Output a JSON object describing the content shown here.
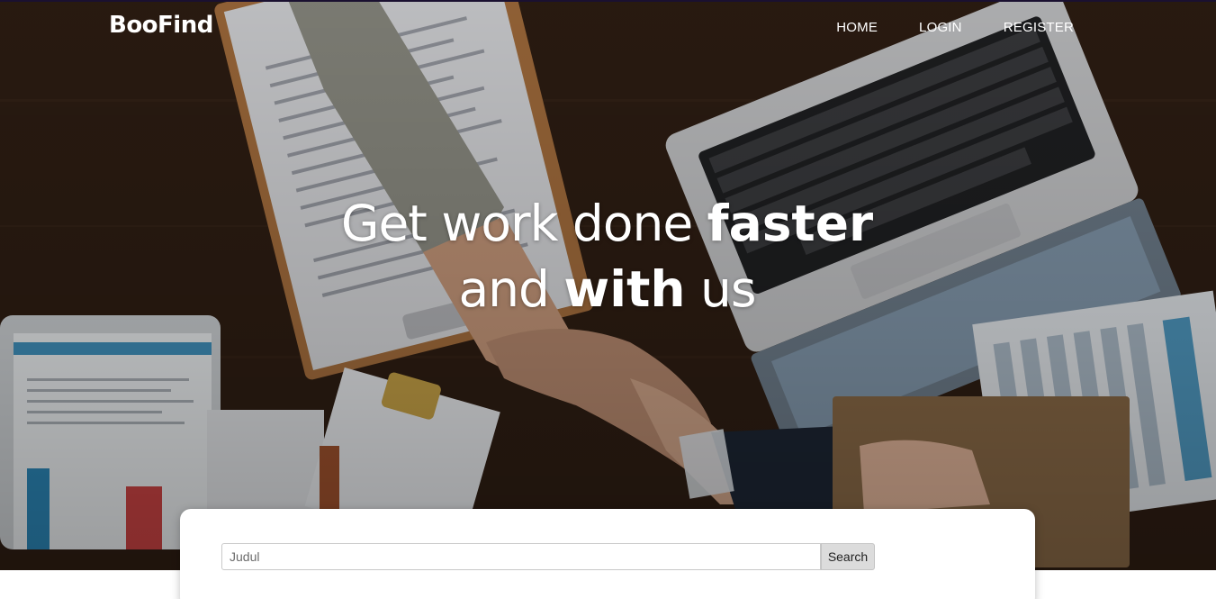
{
  "brand": {
    "name": "BooFind"
  },
  "nav": {
    "items": [
      {
        "label": "HOME"
      },
      {
        "label": "LOGIN"
      },
      {
        "label": "REGISTER"
      }
    ]
  },
  "hero": {
    "headline_line1_normal": "Get work done ",
    "headline_line1_bold": "faster",
    "headline_line2_normal_a": "and ",
    "headline_line2_bold": "with",
    "headline_line2_normal_b": " us"
  },
  "search": {
    "placeholder": "Judul",
    "button_label": "Search"
  },
  "colors": {
    "hero_background": "#2d1d12",
    "text_on_hero": "#ffffff",
    "card_background": "#ffffff",
    "button_background": "#dcdcdc"
  }
}
